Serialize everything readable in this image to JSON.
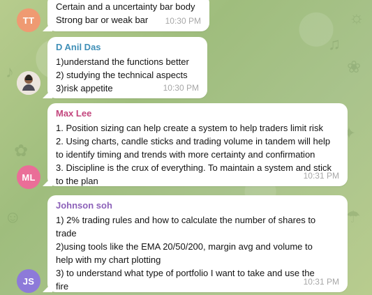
{
  "chat": {
    "background_color": "#a9c28a",
    "messages": [
      {
        "sender": "",
        "avatar_initials": "TT",
        "avatar_color": "#ef9a72",
        "lines": [
          "Certain and a uncertainty bar body",
          "Strong bar or weak bar"
        ],
        "time": "10:30 PM"
      },
      {
        "sender": "D Anil Das",
        "sender_color": "#3f8fb7",
        "lines": [
          "1)understand the functions better",
          "2) studying the technical aspects",
          "3)risk appetite"
        ],
        "time": "10:30 PM"
      },
      {
        "sender": "Max Lee",
        "sender_color": "#c3457d",
        "avatar_initials": "ML",
        "avatar_color": "#ea6e98",
        "lines": [
          "1. Position sizing can help create a system to help traders limit risk",
          "2. Using charts, candle sticks and trading volume in tandem will help",
          "to identify timing and trends with more certainty and confirmation",
          "3. Discipline is the crux of everything. To maintain a system and stick",
          "to the plan"
        ],
        "time": "10:31 PM"
      },
      {
        "sender": "Johnson soh",
        "sender_color": "#8c61b9",
        "avatar_initials": "JS",
        "avatar_color": "#8d7ad9",
        "lines": [
          "1) 2% trading rules and how to calculate the number of shares to",
          "trade",
          "2)using tools like the EMA 20/50/200, margin avg and volume to",
          "help with my chart plotting",
          "3) to understand what type of portfolio I want to take and use the",
          "fire"
        ],
        "time": "10:31 PM"
      }
    ]
  }
}
